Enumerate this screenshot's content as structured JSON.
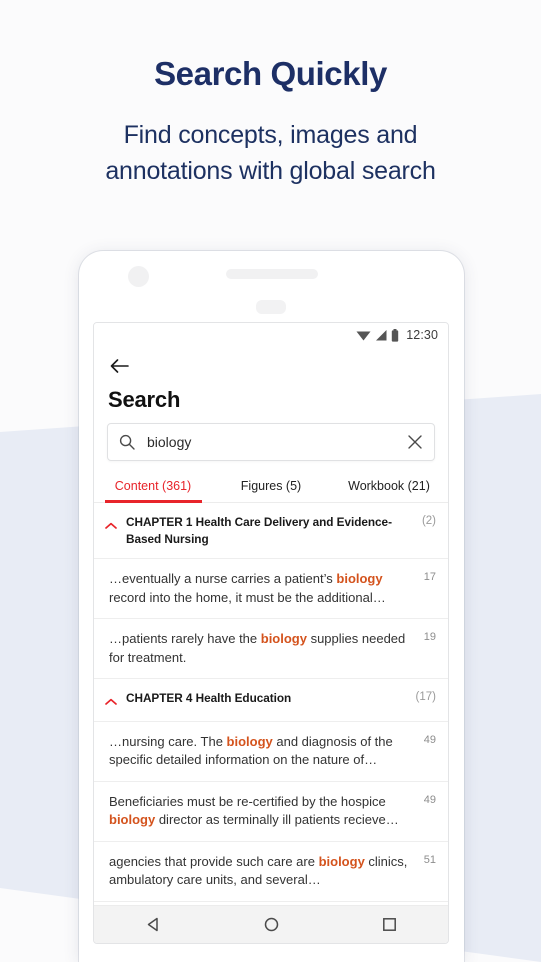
{
  "page": {
    "title": "Search Quickly",
    "subtitle_line1": "Find concepts, images and",
    "subtitle_line2": "annotations with global search",
    "heading_color": "#1d2f66",
    "background_color": "#fbfbfc",
    "band_color": "#e8ecf5"
  },
  "phone": {
    "status_bar": {
      "clock": "12:30",
      "icons": [
        "wifi-icon",
        "signal-icon",
        "battery-icon"
      ]
    },
    "app_bar": {
      "back_icon": "arrow-left-icon",
      "title": "Search"
    },
    "search": {
      "search_icon": "search-icon",
      "value": "biology",
      "placeholder": "Search",
      "clear_icon": "close-icon"
    },
    "tabs": [
      {
        "label": "Content (361)",
        "active": true
      },
      {
        "label": "Figures (5)",
        "active": false
      },
      {
        "label": "Workbook (21)",
        "active": false
      }
    ],
    "accent_color": "#e8242a",
    "highlight_color": "#d4531d",
    "results": [
      {
        "kind": "chapter",
        "chevron": "chevron-up-icon",
        "title": "CHAPTER 1 Health Care Delivery and Evidence-Based Nursing",
        "count": "(2)"
      },
      {
        "kind": "result",
        "pre": "…eventually a nurse carries a patient’s ",
        "hl": "biology",
        "post": " record into the home, it must be the additional…",
        "page": "17"
      },
      {
        "kind": "result",
        "pre": "…patients rarely have the ",
        "hl": "biology",
        "post": " supplies needed for treatment.",
        "page": "19"
      },
      {
        "kind": "chapter",
        "chevron": "chevron-up-icon",
        "title": "CHAPTER 4 Health Education",
        "count": "(17)"
      },
      {
        "kind": "result",
        "pre": "…nursing care. The ",
        "hl": "biology",
        "post": " and diagnosis of the specific detailed information on the nature of…",
        "page": "49"
      },
      {
        "kind": "result",
        "pre": "Beneficiaries must be re-certified by the hospice ",
        "hl": "biology",
        "post": " director as terminally ill patients recieve…",
        "page": "49"
      },
      {
        "kind": "result",
        "pre": "agencies that provide such care are ",
        "hl": "biology",
        "post": " clinics, ambulatory care units, and several…",
        "page": "51"
      }
    ],
    "nav_bar": {
      "back": "triangle-back-icon",
      "home": "circle-home-icon",
      "recents": "square-recents-icon"
    }
  }
}
